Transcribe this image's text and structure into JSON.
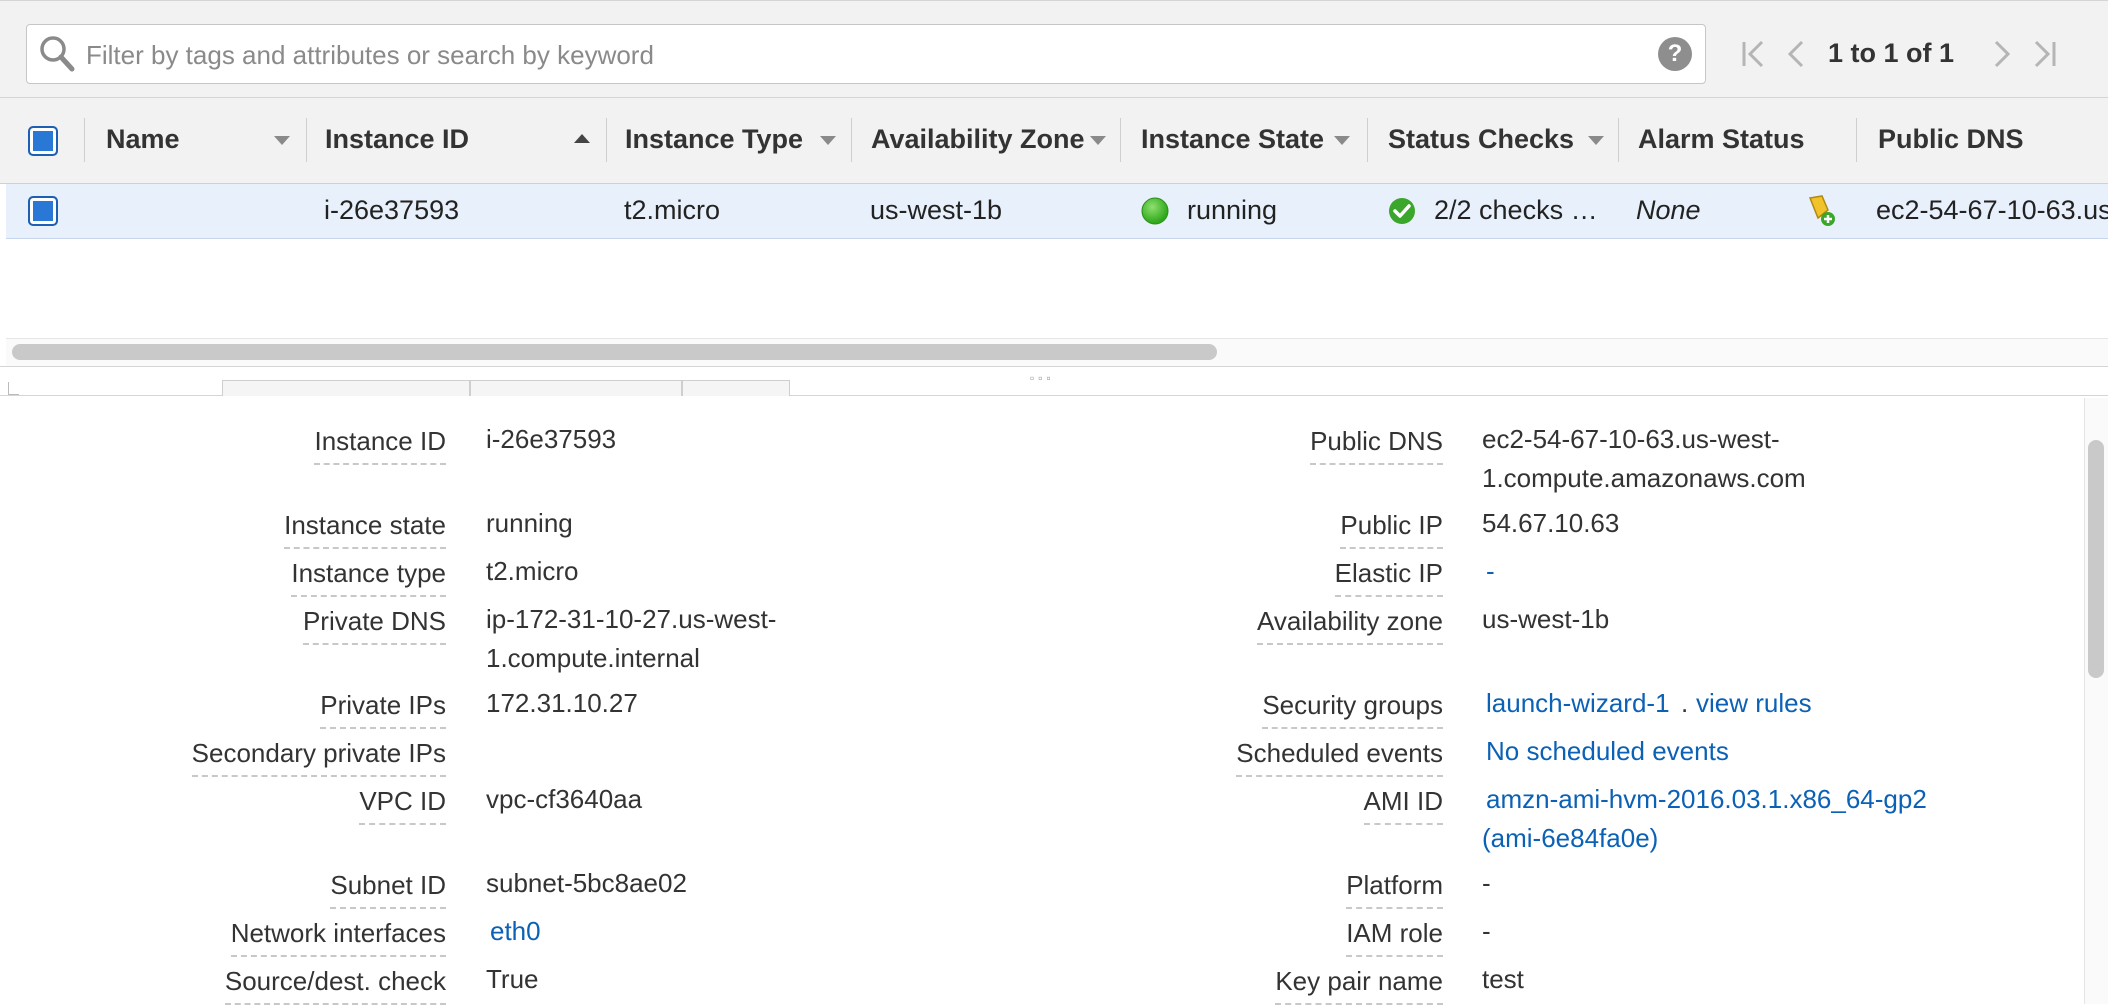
{
  "search": {
    "placeholder": "Filter by tags and attributes or search by keyword",
    "help_label": "?"
  },
  "pager": {
    "text": "1 to 1 of 1"
  },
  "columns": [
    "Name",
    "Instance ID",
    "Instance Type",
    "Availability Zone",
    "Instance State",
    "Status Checks",
    "Alarm Status",
    "Public DNS"
  ],
  "row": {
    "name": "",
    "instance_id": "i-26e37593",
    "instance_type": "t2.micro",
    "availability_zone": "us-west-1b",
    "instance_state": "running",
    "status_checks": "2/2 checks …",
    "alarm_status": "None",
    "public_dns": "ec2-54-67-10-63.us-"
  },
  "details": {
    "left": [
      {
        "label": "Instance ID",
        "value": "i-26e37593"
      },
      {
        "label": "Instance state",
        "value": "running"
      },
      {
        "label": "Instance type",
        "value": "t2.micro"
      },
      {
        "label": "Private DNS",
        "value_line1": "ip-172-31-10-27.us-west-",
        "value_line2": "1.compute.internal"
      },
      {
        "label": "Private IPs",
        "value": "172.31.10.27"
      },
      {
        "label": "Secondary private IPs",
        "value": ""
      },
      {
        "label": "VPC ID",
        "value": "vpc-cf3640aa"
      },
      {
        "label": "Subnet ID",
        "value": "subnet-5bc8ae02"
      },
      {
        "label": "Network interfaces",
        "value": "eth0"
      },
      {
        "label": "Source/dest. check",
        "value": "True"
      }
    ],
    "right": [
      {
        "label": "Public DNS",
        "value_line1": "ec2-54-67-10-63.us-west-",
        "value_line2": "1.compute.amazonaws.com"
      },
      {
        "label": "Public IP",
        "value": "54.67.10.63"
      },
      {
        "label": "Elastic IP",
        "value": "-"
      },
      {
        "label": "Availability zone",
        "value": "us-west-1b"
      },
      {
        "label": "Security groups",
        "value": "launch-wizard-1",
        "separator": ".",
        "extra": "view rules"
      },
      {
        "label": "Scheduled events",
        "value": "No scheduled events"
      },
      {
        "label": "AMI ID",
        "value_line1": "amzn-ami-hvm-2016.03.1.x86_64-gp2",
        "value_line2": "(ami-6e84fa0e)"
      },
      {
        "label": "Platform",
        "value": "-"
      },
      {
        "label": "IAM role",
        "value": "-"
      },
      {
        "label": "Key pair name",
        "value": "test"
      }
    ]
  },
  "colors": {
    "link": "#0b61b6",
    "running": "#3fbf2a",
    "selected_row": "#e8f0fb"
  },
  "icons": {
    "search": "search-icon",
    "help": "help-icon",
    "first": "first-page-icon",
    "prev": "prev-page-icon",
    "next": "next-page-icon",
    "last": "last-page-icon",
    "running": "running-status-icon",
    "checks": "check-circle-icon",
    "alarm": "add-alarm-icon"
  }
}
